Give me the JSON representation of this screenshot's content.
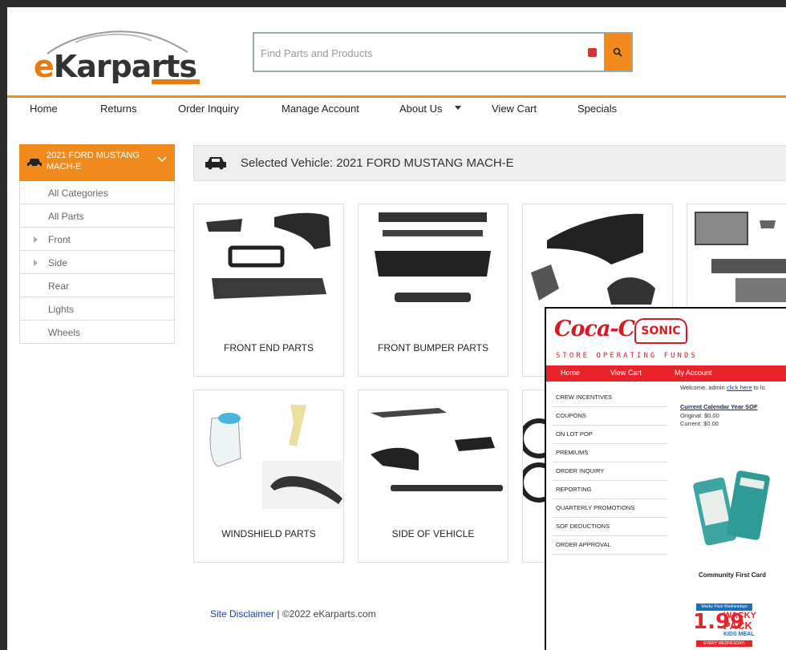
{
  "site": {
    "logo_text": "eKarparts",
    "search_placeholder": "Find Parts and Products"
  },
  "nav": {
    "items": [
      "Home",
      "Returns",
      "Order Inquiry",
      "Manage Account",
      "About Us",
      "View Cart",
      "Specials"
    ]
  },
  "sidebar": {
    "vehicle": "2021 FORD MUSTANG MACH-E",
    "items": [
      "All Categories",
      "All Parts",
      "Front",
      "Side",
      "Rear",
      "Lights",
      "Wheels"
    ]
  },
  "selected": {
    "label": "Selected Vehicle: 2021 FORD MUSTANG MACH-E"
  },
  "categories": [
    "FRONT END PARTS",
    "FRONT BUMPER PARTS",
    "WINDSHIELD PARTS",
    "SIDE OF VEHICLE"
  ],
  "footer": {
    "link": "Site Disclaimer",
    "sep": " | ",
    "copyright": "©2022 eKarparts.com"
  },
  "overlay": {
    "brand1": "Coca-Cola.",
    "brand2": "SONIC",
    "subtitle": "STORE OPERATING FUNDS",
    "nav": [
      "Home",
      "View Cart",
      "My Account"
    ],
    "welcome": "Welcome, admin ",
    "click_here": "click here",
    "welcome_tail": " to lo",
    "sof_title": "Current Calendar Year SOF",
    "original": "Original: $0.00",
    "current": "Current: $0.00",
    "menu": [
      "CREW INCENTIVES",
      "COUPONS",
      "ON LOT POP",
      "PREMIUMS",
      "ORDER INQUIRY",
      "REPORTING",
      "QUARTERLY PROMOTIONS",
      "SOF DEDUCTIONS",
      "ORDER APPROVAL"
    ],
    "card_label": "Community First Card",
    "promo_head": "Wacky Pack Wednesdays",
    "promo_price": "1.99",
    "promo_name1": "WACKY",
    "promo_name2": "PACK",
    "promo_name3": "KIDS MEAL",
    "promo_foot": "EVERY WEDNESDAY!"
  },
  "colors": {
    "accent": "#f08a1c",
    "coke_red": "#d41d22"
  }
}
